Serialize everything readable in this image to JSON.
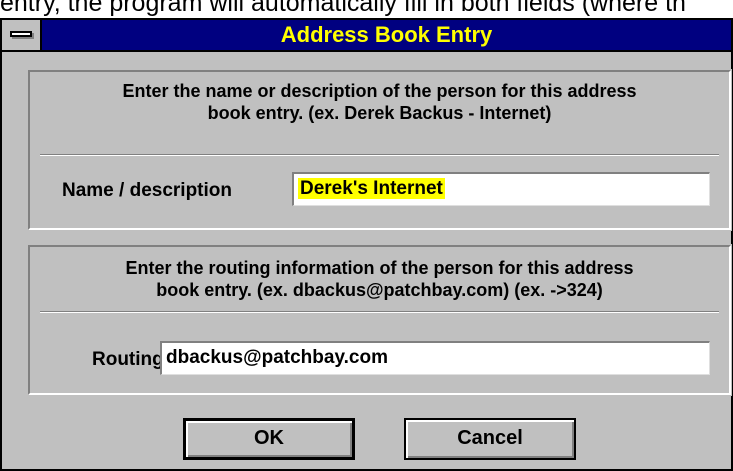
{
  "background": {
    "text": "entry, the program will automatically fill in both fields (where th"
  },
  "dialog": {
    "title": "Address Book Entry",
    "colors": {
      "titlebar": "#000080",
      "title_text": "#ffff00",
      "face": "#c0c0c0"
    },
    "name_section": {
      "instruction_line1": "Enter the name or description of the person for this address",
      "instruction_line2": "book entry.  (ex. Derek Backus - Internet)",
      "label": "Name / description",
      "value": "Derek's Internet"
    },
    "routing_section": {
      "instruction_line1": "Enter the routing information of the person for this address",
      "instruction_line2": "book entry.  (ex. dbackus@patchbay.com)  (ex. ->324)",
      "label": "Routing",
      "value": "dbackus@patchbay.com"
    },
    "buttons": {
      "ok": "OK",
      "cancel": "Cancel"
    }
  }
}
